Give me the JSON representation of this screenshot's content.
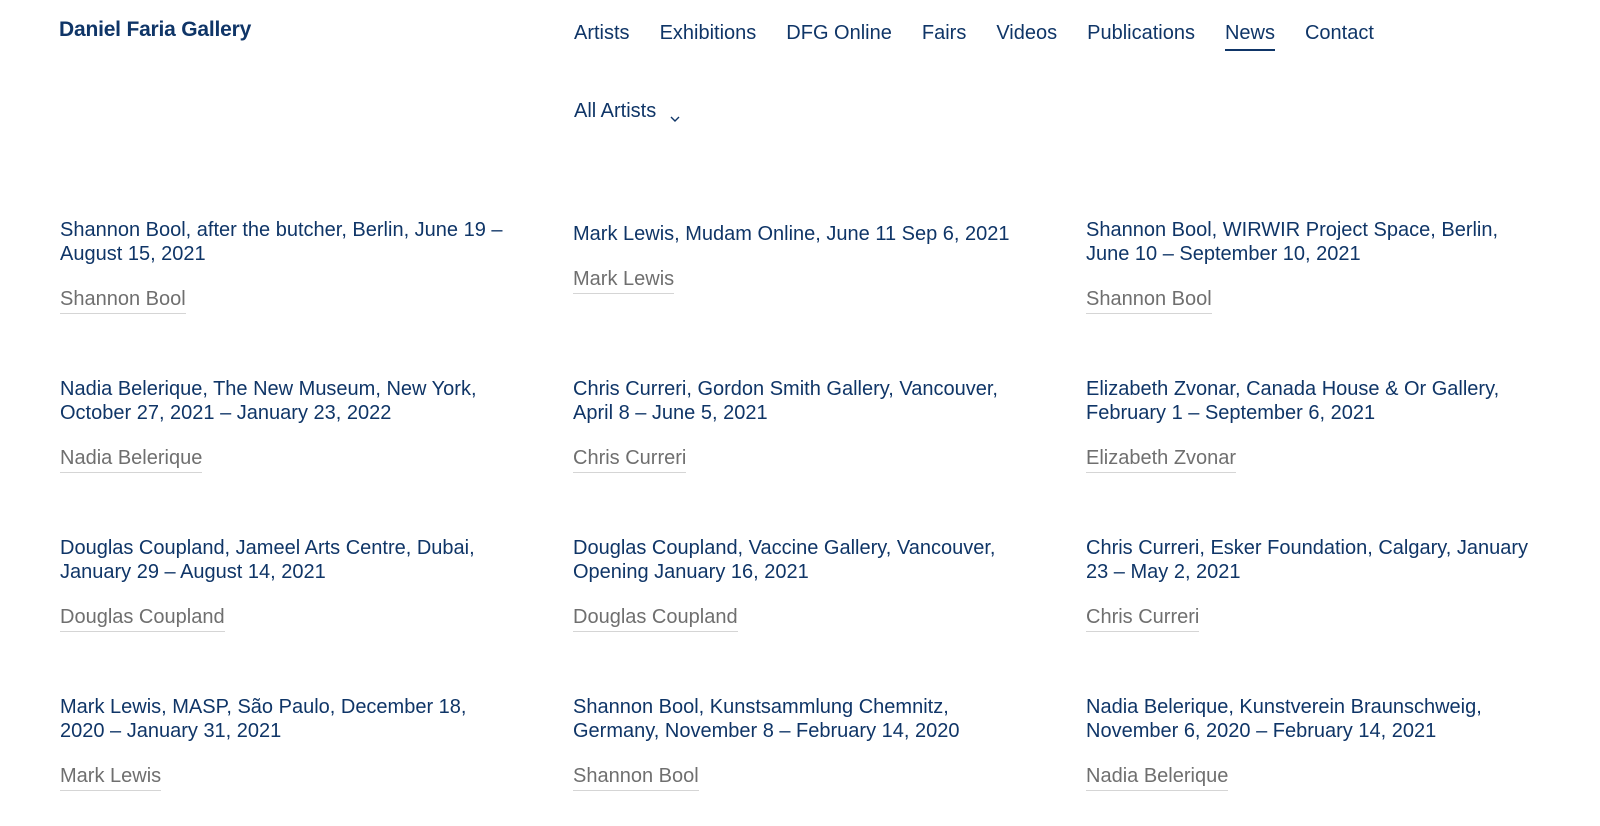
{
  "site": {
    "logo": "Daniel Faria Gallery"
  },
  "nav": [
    {
      "label": "Artists",
      "active": false
    },
    {
      "label": "Exhibitions",
      "active": false
    },
    {
      "label": "DFG Online",
      "active": false
    },
    {
      "label": "Fairs",
      "active": false
    },
    {
      "label": "Videos",
      "active": false
    },
    {
      "label": "Publications",
      "active": false
    },
    {
      "label": "News",
      "active": true
    },
    {
      "label": "Contact",
      "active": false
    }
  ],
  "filter": {
    "label": "All Artists",
    "icon": "chevron-down-icon"
  },
  "news": [
    {
      "title": "Shannon Bool, after the butcher, Berlin, June 19 – August 15, 2021",
      "artist": "Shannon Bool"
    },
    {
      "title": "Mark Lewis, Mudam Online, June 11 Sep 6, 2021",
      "artist": "Mark Lewis"
    },
    {
      "title": "Shannon Bool, WIRWIR Project Space, Berlin, June 10 – September 10, 2021",
      "artist": "Shannon Bool"
    },
    {
      "title": "Nadia Belerique, The New Museum, New York, October 27, 2021 – January 23, 2022",
      "artist": "Nadia Belerique"
    },
    {
      "title": "Chris Curreri, Gordon Smith Gallery, Vancouver, April 8 – June 5, 2021",
      "artist": "Chris Curreri"
    },
    {
      "title": "Elizabeth Zvonar, Canada House & Or Gallery, February 1 – September 6, 2021",
      "artist": "Elizabeth Zvonar"
    },
    {
      "title": "Douglas Coupland, Jameel Arts Centre, Dubai, January 29 – August 14, 2021",
      "artist": "Douglas Coupland"
    },
    {
      "title": "Douglas Coupland, Vaccine Gallery, Vancouver, Opening January 16, 2021",
      "artist": "Douglas Coupland"
    },
    {
      "title": "Chris Curreri, Esker Foundation, Calgary, January 23 – May 2, 2021",
      "artist": "Chris Curreri"
    },
    {
      "title": "Mark Lewis, MASP, São Paulo, December 18, 2020 – January 31, 2021",
      "artist": "Mark Lewis"
    },
    {
      "title": "Shannon Bool, Kunstsammlung Chemnitz, Germany, November 8 – February 14, 2020",
      "artist": "Shannon Bool"
    },
    {
      "title": "Nadia Belerique, Kunstverein Braunschweig, November 6, 2020 – February 14, 2021",
      "artist": "Nadia Belerique"
    }
  ]
}
